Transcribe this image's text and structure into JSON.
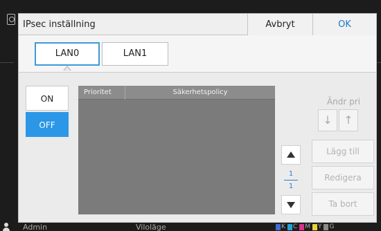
{
  "dialog": {
    "title": "IPsec inställning",
    "cancel_label": "Avbryt",
    "ok_label": "OK"
  },
  "tabs": [
    {
      "label": "LAN0",
      "selected": true
    },
    {
      "label": "LAN1",
      "selected": false
    }
  ],
  "toggle": {
    "on_label": "ON",
    "off_label": "OFF",
    "selected": "OFF"
  },
  "policy_table": {
    "columns": [
      "Prioritet",
      "Säkerhetspolicy"
    ],
    "rows": []
  },
  "pager": {
    "current": "1",
    "total": "1"
  },
  "priority_change": {
    "label": "Ändr pri",
    "down_glyph": "↓",
    "up_glyph": "↑"
  },
  "actions": {
    "add_label": "Lägg till",
    "edit_label": "Redigera",
    "delete_label": "Ta bort"
  },
  "status_bar": {
    "user": "Admin",
    "mode": "Viloläge",
    "inks": [
      {
        "letter": "K",
        "color": "#1a1a1a"
      },
      {
        "letter": "C",
        "color": "#1fa3d8"
      },
      {
        "letter": "M",
        "color": "#d6338a"
      },
      {
        "letter": "Y",
        "color": "#e8d23a"
      },
      {
        "letter": "G",
        "color": "#8a8a8a"
      }
    ]
  },
  "colors": {
    "accent": "#2b97e6",
    "ok_text": "#1b78c8",
    "table_bg": "#7b7b7b"
  }
}
